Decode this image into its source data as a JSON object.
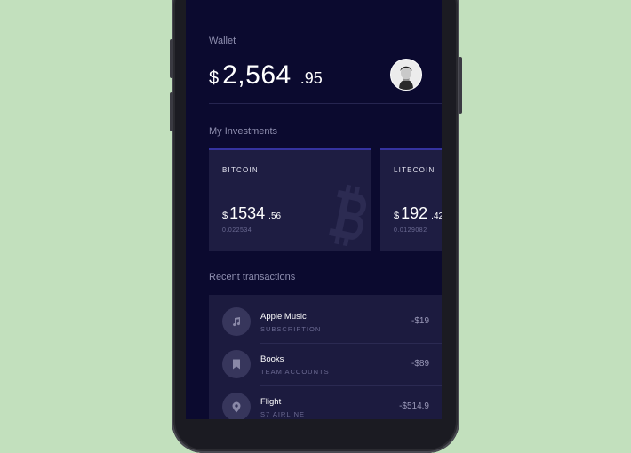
{
  "wallet": {
    "label": "Wallet",
    "currency": "$",
    "balance_int": "2,564",
    "balance_dec": ".95"
  },
  "investments": {
    "title": "My Investments",
    "cards": [
      {
        "name": "BITCOIN",
        "currency": "$",
        "value_int": "1534",
        "value_dec": ".56",
        "amount": "0.022534",
        "icon": "bitcoin-icon"
      },
      {
        "name": "LITECOIN",
        "currency": "$",
        "value_int": "192",
        "value_dec": ".42",
        "amount": "0.0129082",
        "icon": "litecoin-icon"
      }
    ]
  },
  "transactions": {
    "title": "Recent transactions",
    "items": [
      {
        "name": "Apple Music",
        "subtitle": "SUBSCRIPTION",
        "amount": "-$19",
        "icon": "music-note-icon"
      },
      {
        "name": "Books",
        "subtitle": "TEAM ACCOUNTS",
        "amount": "-$89",
        "icon": "bookmark-icon"
      },
      {
        "name": "Flight",
        "subtitle": "S7 AIRLINE",
        "amount": "-$514.9",
        "icon": "location-pin-icon"
      }
    ]
  },
  "colors": {
    "background": "#c2e0bd",
    "screen": "#0b0a2f",
    "card": "#1e1d42",
    "accent": "#3533a0"
  }
}
